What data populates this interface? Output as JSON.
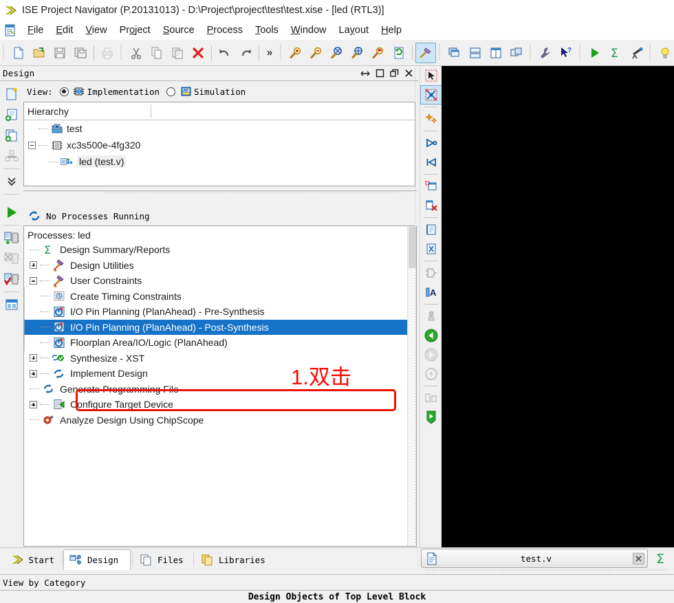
{
  "window": {
    "title": "ISE Project Navigator (P.20131013) - D:\\Project\\project\\test\\test.xise - [led (RTL3)]",
    "app_icon": "ise-arrow-icon"
  },
  "menubar": {
    "icon": "project-navigator-icon",
    "items": [
      {
        "label": "File",
        "accel": "F"
      },
      {
        "label": "Edit",
        "accel": "E"
      },
      {
        "label": "View",
        "accel": "V"
      },
      {
        "label": "Project",
        "accel": "o"
      },
      {
        "label": "Source",
        "accel": "S"
      },
      {
        "label": "Process",
        "accel": "P"
      },
      {
        "label": "Tools",
        "accel": "T"
      },
      {
        "label": "Window",
        "accel": "W"
      },
      {
        "label": "Layout",
        "accel": "y"
      },
      {
        "label": "Help",
        "accel": "H"
      }
    ]
  },
  "toolbar": {
    "groups": [
      {
        "buttons": [
          {
            "name": "new-file-icon",
            "enabled": true
          },
          {
            "name": "open-file-icon",
            "enabled": true
          },
          {
            "name": "save-icon",
            "enabled": true
          },
          {
            "name": "save-all-icon",
            "enabled": true
          },
          {
            "name": "print-icon",
            "enabled": false
          }
        ]
      },
      {
        "buttons": [
          {
            "name": "cut-icon",
            "enabled": true
          },
          {
            "name": "copy-icon",
            "enabled": true
          },
          {
            "name": "paste-icon",
            "enabled": true
          },
          {
            "name": "delete-icon",
            "enabled": true
          },
          {
            "name": "undo-icon",
            "enabled": true
          },
          {
            "name": "redo-icon",
            "enabled": true
          }
        ],
        "overflow": "»"
      },
      {
        "buttons": [
          {
            "name": "zoom-in-icon",
            "enabled": true
          },
          {
            "name": "zoom-out-icon",
            "enabled": true
          },
          {
            "name": "zoom-fit-icon",
            "enabled": true
          },
          {
            "name": "zoom-selection-icon",
            "enabled": true
          },
          {
            "name": "zoom-area-icon",
            "enabled": true
          },
          {
            "name": "refresh-icon",
            "enabled": true
          },
          {
            "name": "hammer-build-icon",
            "enabled": true,
            "active": true
          }
        ]
      },
      {
        "buttons": [
          {
            "name": "cascade-windows-icon",
            "enabled": true
          },
          {
            "name": "tile-horizontally-icon",
            "enabled": true
          },
          {
            "name": "tile-vertically-icon",
            "enabled": true
          },
          {
            "name": "new-window-icon",
            "enabled": true
          }
        ]
      },
      {
        "buttons": [
          {
            "name": "wrench-settings-icon",
            "enabled": true
          },
          {
            "name": "context-help-icon",
            "enabled": true
          }
        ]
      },
      {
        "buttons": [
          {
            "name": "run-icon",
            "enabled": true
          },
          {
            "name": "design-summary-sigma-icon",
            "enabled": true
          },
          {
            "name": "telescope-explore-icon",
            "enabled": true
          }
        ]
      },
      {
        "buttons": [
          {
            "name": "lightbulb-tip-icon",
            "enabled": true
          }
        ]
      }
    ]
  },
  "left_toolbar": {
    "buttons": [
      {
        "name": "new-source-icon"
      },
      {
        "name": "add-source-icon"
      },
      {
        "name": "add-copy-source-icon"
      },
      {
        "name": "manage-configuration-icon",
        "enabled": false
      },
      {
        "name": "more-chevrons-icon"
      },
      {
        "name": "run-process-icon"
      },
      {
        "name": "implement-top-module-icon"
      },
      {
        "name": "rerun-all-icon"
      },
      {
        "name": "check-syntax-icon"
      },
      {
        "name": "design-summary-panel-icon"
      }
    ]
  },
  "design_panel": {
    "caption": "Design",
    "caption_buttons": [
      {
        "name": "float-resize-icon"
      },
      {
        "name": "maximize-icon"
      },
      {
        "name": "restore-icon"
      },
      {
        "name": "close-icon"
      }
    ],
    "view_row": {
      "label": "View:",
      "options": [
        {
          "label": "Implementation",
          "selected": true,
          "icon": "chip-implementation-icon"
        },
        {
          "label": "Simulation",
          "selected": false,
          "icon": "simulation-waveform-icon"
        }
      ]
    },
    "hierarchy": {
      "header": "Hierarchy",
      "nodes": [
        {
          "label": "test",
          "icon": "project-folder-icon",
          "level": 1,
          "expander": "none",
          "selected": false
        },
        {
          "label": "xc3s500e-4fg320",
          "icon": "device-chip-icon",
          "level": 0,
          "expander": "minus",
          "selected": false
        },
        {
          "label": "led (test.v)",
          "icon": "verilog-module-icon",
          "level": 2,
          "expander": "none",
          "selected": true
        }
      ]
    },
    "status_running": {
      "icon": "process-refresh-icon",
      "text": "No Processes Running"
    },
    "processes": {
      "title": "Processes: led",
      "items": [
        {
          "label": "Design Summary/Reports",
          "icon": "sigma-report-icon",
          "level": 1,
          "expander": "none",
          "selected": false
        },
        {
          "label": "Design Utilities",
          "icon": "hammer-wrench-icon",
          "level": 0,
          "expander": "plus",
          "selected": false
        },
        {
          "label": "User Constraints",
          "icon": "hammer-wrench-icon",
          "level": 0,
          "expander": "minus",
          "selected": false
        },
        {
          "label": "Create Timing Constraints",
          "icon": "timing-constraints-icon",
          "level": 2,
          "expander": "none",
          "selected": false
        },
        {
          "label": "I/O Pin Planning (PlanAhead) - Pre-Synthesis",
          "icon": "planahead-pin-icon",
          "level": 2,
          "expander": "none",
          "selected": false
        },
        {
          "label": "I/O Pin Planning (PlanAhead) - Post-Synthesis",
          "icon": "planahead-pin-icon",
          "level": 2,
          "expander": "none",
          "selected": true
        },
        {
          "label": "Floorplan Area/IO/Logic (PlanAhead)",
          "icon": "planahead-pin-icon",
          "level": 2,
          "expander": "none",
          "selected": false
        },
        {
          "label": "Synthesize - XST",
          "icon": "process-done-icon",
          "level": 0,
          "expander": "plus",
          "selected": false
        },
        {
          "label": "Implement Design",
          "icon": "process-refresh-icon",
          "level": 0,
          "expander": "plus",
          "selected": false
        },
        {
          "label": "Generate Programming File",
          "icon": "process-refresh-icon",
          "level": 1,
          "expander": "none",
          "selected": false
        },
        {
          "label": "Configure Target Device",
          "icon": "configure-device-icon",
          "level": 0,
          "expander": "plus",
          "selected": false
        },
        {
          "label": "Analyze Design Using ChipScope",
          "icon": "chipscope-icon",
          "level": 1,
          "expander": "none",
          "selected": false
        }
      ]
    }
  },
  "annotation": {
    "text": "1.双击",
    "color": "#fa0a00",
    "box_color": "#f01000"
  },
  "right_toolbar": {
    "buttons": [
      {
        "name": "select-tool-icon"
      },
      {
        "name": "area-select-tool-icon",
        "active": true
      },
      {
        "name": "highlight-stars-icon"
      },
      {
        "name": "expand-right-icon"
      },
      {
        "name": "expand-left-icon"
      },
      {
        "name": "add-to-schematic-icon"
      },
      {
        "name": "remove-from-schematic-icon"
      },
      {
        "name": "open-schematic-icon"
      },
      {
        "name": "close-schematic-icon"
      },
      {
        "name": "view-symbol-icon",
        "enabled": false
      },
      {
        "name": "toggle-name-icon"
      },
      {
        "name": "pin-marker-icon",
        "enabled": false
      },
      {
        "name": "back-icon"
      },
      {
        "name": "forward-icon",
        "enabled": false
      },
      {
        "name": "reset-view-icon",
        "enabled": false
      },
      {
        "name": "compare-panes-icon",
        "enabled": false
      },
      {
        "name": "bookmark-icon"
      }
    ]
  },
  "bottom_tabs": {
    "tabs": [
      {
        "label": "Start",
        "icon": "start-arrow-icon",
        "selected": false
      },
      {
        "label": "Design",
        "icon": "design-tree-icon",
        "selected": true
      },
      {
        "label": "Files",
        "icon": "files-icon",
        "selected": false
      },
      {
        "label": "Libraries",
        "icon": "libraries-icon",
        "selected": false
      }
    ]
  },
  "editor_tab": {
    "name": "test.v",
    "icon": "verilog-file-icon",
    "close_icon": "close-icon",
    "sigma_icon": "design-summary-sigma-icon"
  },
  "statusbar": {
    "text": "View by Category"
  },
  "bottom_title": {
    "text": "Design Objects of Top Level Block"
  }
}
